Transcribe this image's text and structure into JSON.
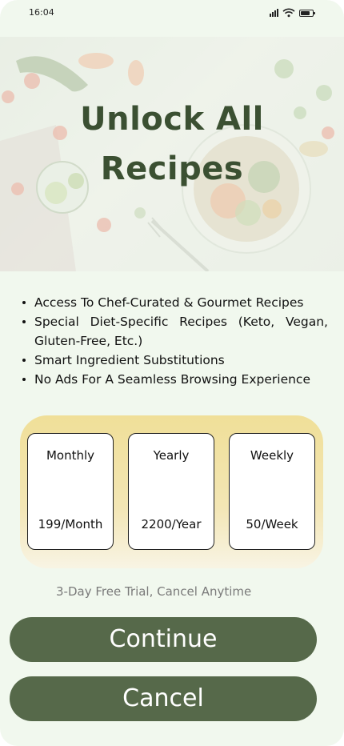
{
  "status_bar": {
    "time": "16:04"
  },
  "hero": {
    "title_line1": "Unlock All",
    "title_line2": "Recipes"
  },
  "features": [
    "Access To Chef-Curated & Gourmet Recipes",
    "Special Diet-Specific Recipes (Keto, Vegan, Gluten-Free, Etc.)",
    "Smart Ingredient Substitutions",
    "No Ads For A Seamless Browsing Experience"
  ],
  "plans": [
    {
      "name": "Monthly",
      "price": "199/Month"
    },
    {
      "name": "Yearly",
      "price": "2200/Year"
    },
    {
      "name": "Weekly",
      "price": "50/Week"
    }
  ],
  "trial_note": "3-Day Free Trial, Cancel Anytime",
  "buttons": {
    "continue_label": "Continue",
    "cancel_label": "Cancel"
  },
  "colors": {
    "primary_button": "#56694a",
    "title": "#3b5032",
    "plans_panel": "#f0df98",
    "background": "#f1f8ee"
  }
}
